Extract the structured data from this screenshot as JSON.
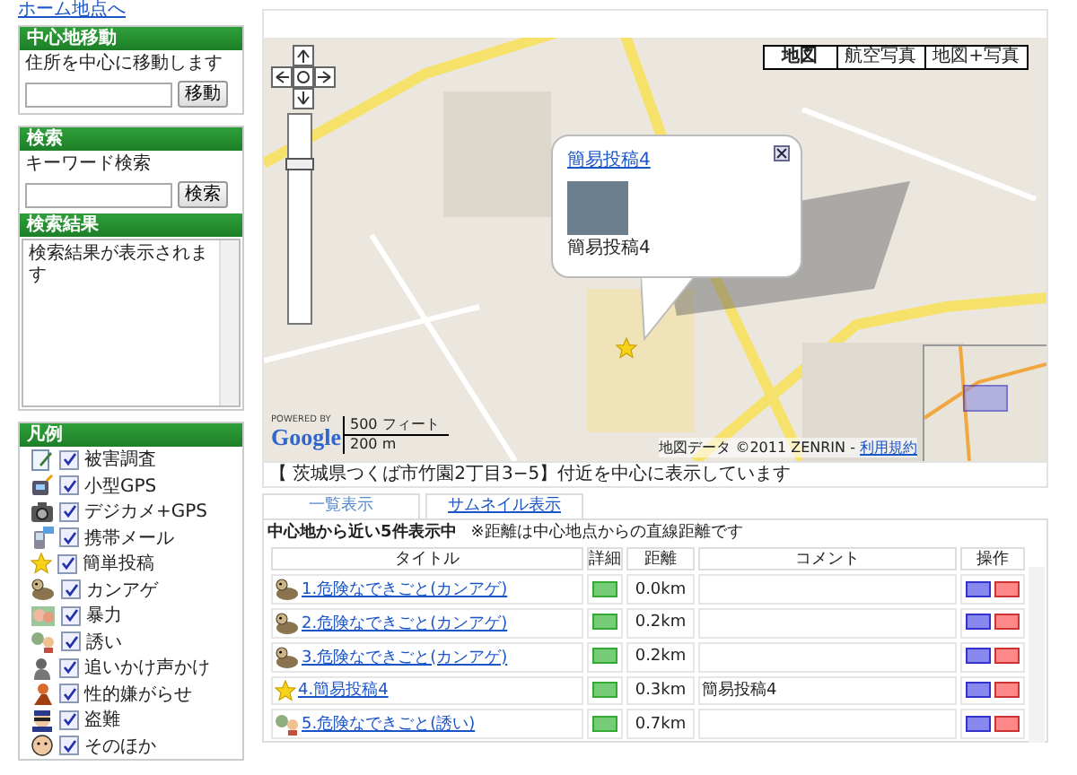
{
  "home_link": "ホーム地点へ",
  "center_move": {
    "title": "中心地移動",
    "description": "住所を中心に移動します",
    "button": "移動"
  },
  "search": {
    "title": "検索",
    "label": "キーワード検索",
    "button": "検索"
  },
  "search_results": {
    "title": "検索結果",
    "text": "検索結果が表示されます"
  },
  "legend": {
    "title": "凡例",
    "items": [
      {
        "label": "被害調査",
        "kind": "memo",
        "checked": true
      },
      {
        "label": "小型GPS",
        "kind": "device",
        "checked": true
      },
      {
        "label": "デジカメ+GPS",
        "kind": "camera",
        "checked": true
      },
      {
        "label": "携帯メール",
        "kind": "phone",
        "checked": true
      },
      {
        "label": "簡単投稿",
        "kind": "star",
        "checked": true
      },
      {
        "label": "カンアゲ",
        "kind": "critter",
        "checked": true
      },
      {
        "label": "暴力",
        "kind": "faces",
        "checked": true
      },
      {
        "label": "誘い",
        "kind": "pair",
        "checked": true
      },
      {
        "label": "追いかけ声かけ",
        "kind": "shadow",
        "checked": true
      },
      {
        "label": "性的嫌がらせ",
        "kind": "figure",
        "checked": true
      },
      {
        "label": "盗難",
        "kind": "thief",
        "checked": true
      },
      {
        "label": "そのほか",
        "kind": "face",
        "checked": true
      }
    ]
  },
  "map": {
    "type_buttons": [
      {
        "label": "地図",
        "selected": true
      },
      {
        "label": "航空写真",
        "selected": false
      },
      {
        "label": "地図+写真",
        "selected": false
      }
    ],
    "zoom_slider": {
      "level": 0.78
    },
    "popup": {
      "title": "簡易投稿4",
      "caption": "簡易投稿4"
    },
    "powered_by": "POWERED BY",
    "logo": "Google",
    "scale": [
      "500 フィート",
      "200 m"
    ],
    "attribution": "地図データ ©2011 ZENRIN - ",
    "terms_link": "利用規約"
  },
  "address_bar": "【 茨城県つくば市竹園2丁目3−5】付近を中心に表示しています",
  "view_tabs": [
    {
      "label": "一覧表示",
      "selected": true
    },
    {
      "label": "サムネイル表示",
      "selected": false
    }
  ],
  "list": {
    "summary": "中心地から近い5件表示中",
    "note": "※距離は中心地点からの直線距離です",
    "columns": [
      "タイトル",
      "詳細",
      "距離",
      "コメント",
      "操作"
    ],
    "rows": [
      {
        "kind": "critter",
        "title": "1.危険なできごと(カンアゲ)",
        "distance": "0.0km"
      },
      {
        "kind": "critter",
        "title": "2.危険なできごと(カンアゲ)",
        "distance": "0.2km"
      },
      {
        "kind": "critter",
        "title": "3.危険なできごと(カンアゲ)",
        "distance": "0.2km"
      },
      {
        "kind": "star",
        "title": "4.簡易投稿4",
        "distance": "0.3km",
        "comment": "簡易投稿4"
      },
      {
        "kind": "pair",
        "title": "5.危険なできごと(誘い)",
        "distance": "0.7km"
      }
    ]
  }
}
